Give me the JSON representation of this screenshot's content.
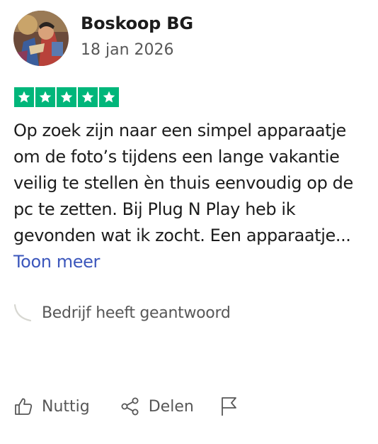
{
  "review": {
    "author": "Boskoop BG",
    "date": "18 jan 2026",
    "rating": 5,
    "rating_max": 5,
    "star_color": "#00b67a",
    "body_text": "Op zoek zijn naar een simpel apparaatje om de foto’s tijdens een lange vakantie veilig te stellen èn thuis eenvoudig op de pc te zetten. Bij Plug N Play heb ik gevonden wat ik zocht. Een apparaatje...",
    "show_more_label": "Toon meer",
    "link_color": "#3c57bc",
    "reply_label": "Bedrijf heeft geantwoord"
  },
  "actions": {
    "useful_label": "Nuttig",
    "share_label": "Delen",
    "icons": [
      "thumbs-up-icon",
      "share-icon",
      "flag-icon"
    ]
  }
}
